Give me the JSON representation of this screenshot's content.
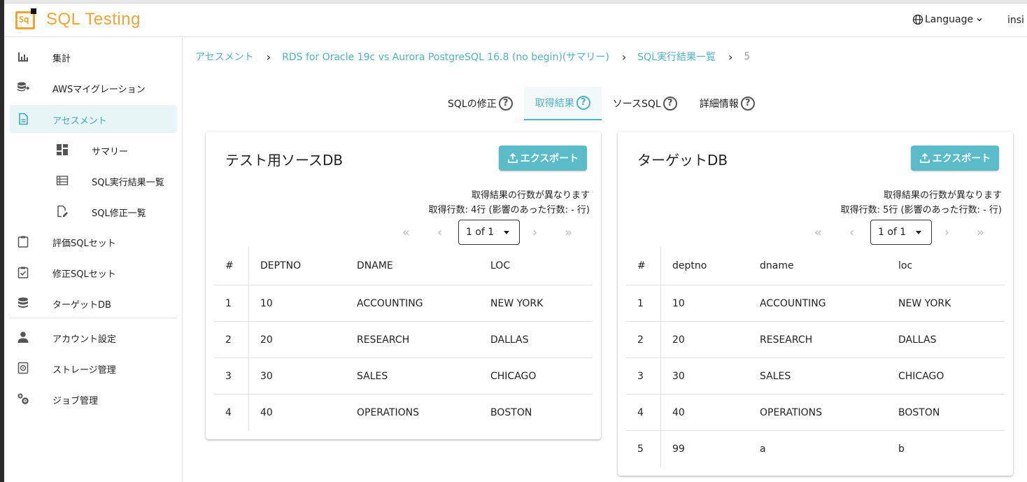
{
  "app": {
    "title": "SQL Testing",
    "logo_text": "Sq",
    "language": "Language",
    "user": "insi"
  },
  "sidebar": {
    "items": [
      {
        "label": "集計"
      },
      {
        "label": "AWSマイグレーション"
      },
      {
        "label": "アセスメント"
      },
      {
        "label": "サマリー"
      },
      {
        "label": "SQL実行結果一覧"
      },
      {
        "label": "SQL修正一覧"
      },
      {
        "label": "評価SQLセット"
      },
      {
        "label": "修正SQLセット"
      },
      {
        "label": "ターゲットDB"
      },
      {
        "label": "アカウント設定"
      },
      {
        "label": "ストレージ管理"
      },
      {
        "label": "ジョブ管理"
      }
    ]
  },
  "breadcrumb": {
    "items": [
      "アセスメント",
      "RDS for Oracle 19c vs Aurora PostgreSQL 16.8 (no begin)(サマリー)",
      "SQL実行結果一覧"
    ],
    "current": "5"
  },
  "tabs": [
    {
      "label": "SQLの修正"
    },
    {
      "label": "取得結果"
    },
    {
      "label": "ソースSQL"
    },
    {
      "label": "詳細情報"
    }
  ],
  "help_glyph": "?",
  "source": {
    "title": "テスト用ソースDB",
    "export_label": "エクスポート",
    "note1": "取得結果の行数が異なります",
    "note2": "取得行数: 4行  (影響のあった行数: - 行)",
    "page": "1 of 1",
    "columns": [
      "#",
      "DEPTNO",
      "DNAME",
      "LOC"
    ],
    "rows": [
      [
        "1",
        "10",
        "ACCOUNTING",
        "NEW YORK"
      ],
      [
        "2",
        "20",
        "RESEARCH",
        "DALLAS"
      ],
      [
        "3",
        "30",
        "SALES",
        "CHICAGO"
      ],
      [
        "4",
        "40",
        "OPERATIONS",
        "BOSTON"
      ]
    ]
  },
  "target": {
    "title": "ターゲットDB",
    "export_label": "エクスポート",
    "note1": "取得結果の行数が異なります",
    "note2": "取得行数: 5行  (影響のあった行数: - 行)",
    "page": "1 of 1",
    "columns": [
      "#",
      "deptno",
      "dname",
      "loc"
    ],
    "rows": [
      [
        "1",
        "10",
        "ACCOUNTING",
        "NEW YORK"
      ],
      [
        "2",
        "20",
        "RESEARCH",
        "DALLAS"
      ],
      [
        "3",
        "30",
        "SALES",
        "CHICAGO"
      ],
      [
        "4",
        "40",
        "OPERATIONS",
        "BOSTON"
      ],
      [
        "5",
        "99",
        "a",
        "b"
      ]
    ]
  },
  "pager_glyphs": {
    "first": "«",
    "prev": "‹",
    "next": "›",
    "last": "»"
  },
  "colors": {
    "accent": "#4fb3c1",
    "logo": "#f2a433",
    "button": "#5bbcc9"
  }
}
